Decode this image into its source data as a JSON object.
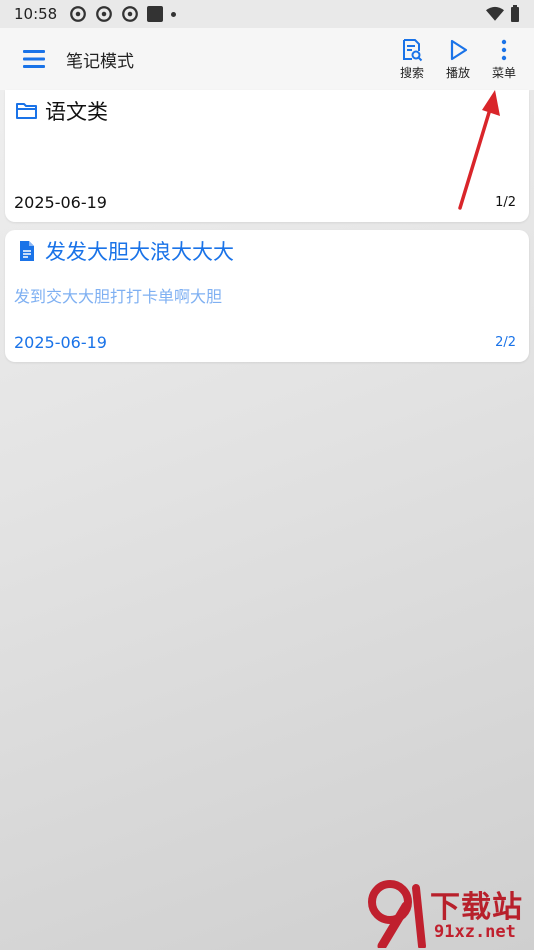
{
  "status_bar": {
    "time": "10:58",
    "icons": [
      "sync-icon",
      "sync-icon",
      "sync-icon",
      "square-icon",
      "dot-icon"
    ],
    "right_icons": [
      "wifi-icon",
      "battery-icon"
    ]
  },
  "app_bar": {
    "title": "笔记模式",
    "actions": [
      {
        "label": "搜索",
        "icon": "search-doc-icon"
      },
      {
        "label": "播放",
        "icon": "play-icon"
      },
      {
        "label": "菜单",
        "icon": "more-vert-icon"
      }
    ]
  },
  "notes": [
    {
      "type": "folder",
      "icon": "folder-icon",
      "title": "语文类",
      "preview": "",
      "date": "2025-06-19",
      "index": "1/2"
    },
    {
      "type": "note",
      "icon": "document-icon",
      "title": "发发大胆大浪大大大",
      "preview": "发到交大大胆打打卡单啊大胆",
      "date": "2025-06-19",
      "index": "2/2"
    }
  ],
  "colors": {
    "accent": "#1a73e8",
    "preview_text": "#7fb0f2",
    "annotation_arrow": "#d9252a",
    "watermark": "#b8202b"
  },
  "watermark": {
    "main": "下载站",
    "sub": "91xz.net"
  }
}
